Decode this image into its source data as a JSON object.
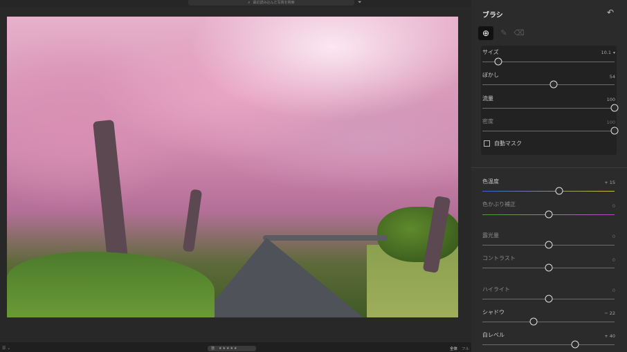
{
  "topbar": {
    "search_placeholder": "最近読み込んだ写真を検索"
  },
  "panel": {
    "title": "ブラシ",
    "brush": {
      "size_label": "サイズ",
      "size_value": "10.1",
      "size_level": 0.12,
      "feather_label": "ぼかし",
      "feather_value": "54",
      "feather_level": 0.54,
      "flow_label": "流量",
      "flow_value": "100",
      "flow_level": 1.0,
      "density_label": "密度",
      "density_value": "100",
      "density_level": 1.0,
      "automask_label": "自動マスク"
    },
    "adjust": {
      "temp_label": "色温度",
      "temp_value": "+ 15",
      "temp_level": 0.58,
      "tint_label": "色かぶり補正",
      "tint_value": "0",
      "tint_level": 0.5,
      "exposure_label": "露光量",
      "exposure_value": "0",
      "exposure_level": 0.5,
      "contrast_label": "コントラスト",
      "contrast_value": "0",
      "contrast_level": 0.5,
      "highlights_label": "ハイライト",
      "highlights_value": "0",
      "highlights_level": 0.5,
      "shadows_label": "シャドウ",
      "shadows_value": "− 22",
      "shadows_level": 0.39,
      "whites_label": "白レベル",
      "whites_value": "+ 40",
      "whites_level": 0.7
    }
  },
  "bottombar": {
    "flag_label": "旗",
    "stars": "★★★★★",
    "view_full": "全体",
    "view_fit": "フル"
  }
}
